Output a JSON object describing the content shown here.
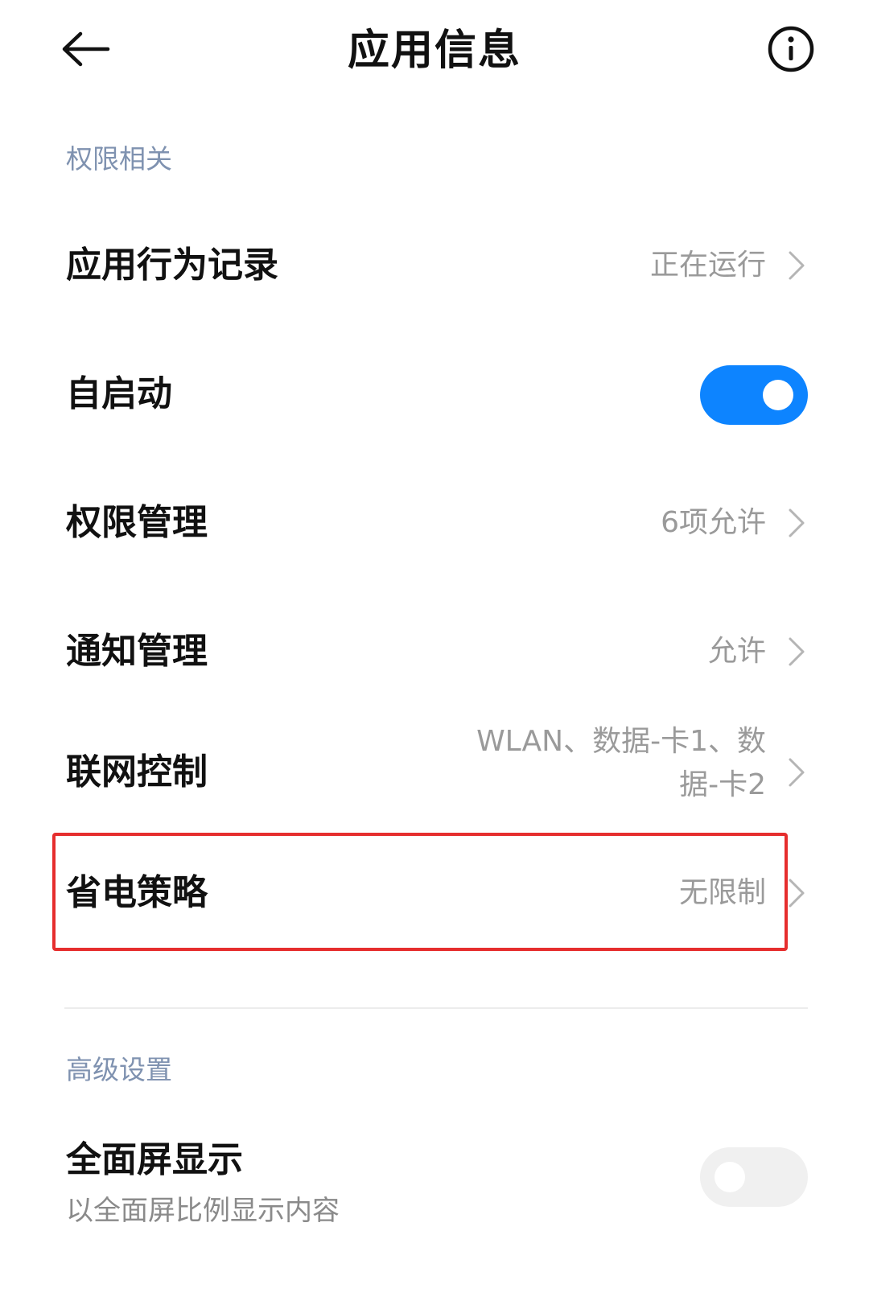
{
  "header": {
    "title": "应用信息",
    "back_icon": "back-arrow-icon",
    "info_icon": "info-icon"
  },
  "sections": {
    "permissions": {
      "title": "权限相关",
      "rows": [
        {
          "label": "应用行为记录",
          "value": "正在运行"
        },
        {
          "label": "自启动",
          "toggle": true
        },
        {
          "label": "权限管理",
          "value": "6项允许"
        },
        {
          "label": "通知管理",
          "value": "允许"
        },
        {
          "label": "联网控制",
          "value_line1": "WLAN、数据-卡1、数",
          "value_line2": "据-卡2"
        },
        {
          "label": "省电策略",
          "value": "无限制"
        }
      ]
    },
    "advanced": {
      "title": "高级设置",
      "fullscreen": {
        "label": "全面屏显示",
        "sublabel": "以全面屏比例显示内容",
        "toggle": false
      }
    }
  },
  "colors": {
    "accent": "#0d84ff",
    "section_title": "#7f92b0",
    "highlight": "#e62e2e",
    "value_text": "#9a9a9a"
  }
}
